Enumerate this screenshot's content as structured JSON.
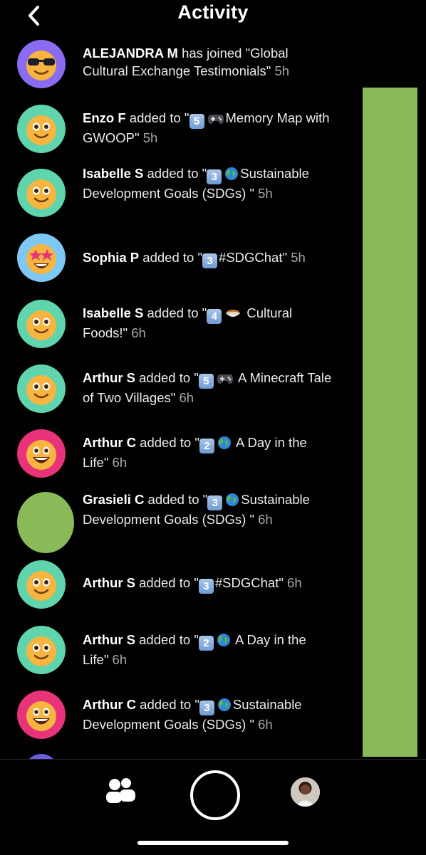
{
  "header": {
    "title": "Activity",
    "back_icon": "chevron-left-icon"
  },
  "feed": [
    {
      "avatar": "sunglasses-face",
      "user": "ALEJANDRA M",
      "pre": " has joined \"Global Cultural Exchange Testimonials\" ",
      "badge": "",
      "emoji": "",
      "text": "",
      "time": "5h"
    },
    {
      "avatar": "smiling-face",
      "user": "Enzo F",
      "pre": " added to \"",
      "badge": "5",
      "emoji": "game-controller",
      "text": "Memory Map with GWOOP\" ",
      "time": "5h"
    },
    {
      "avatar": "smiling-face",
      "user": "Isabelle S",
      "pre": " added to \"",
      "badge": "3",
      "emoji": "globe",
      "text": "Sustainable Development Goals (SDGs) \" ",
      "time": "5h"
    },
    {
      "avatar": "star-struck-face",
      "user": "Sophia P",
      "pre": " added to \"",
      "badge": "3",
      "emoji": "",
      "text": "#SDGChat\" ",
      "time": "5h"
    },
    {
      "avatar": "smiling-face",
      "user": "Isabelle S",
      "pre": " added to \"",
      "badge": "4",
      "emoji": "food-bowl",
      "text": " Cultural Foods!\" ",
      "time": "6h"
    },
    {
      "avatar": "smiling-face",
      "user": "Arthur S",
      "pre": " added to \"",
      "badge": "5",
      "emoji": "game-controller",
      "text": " A Minecraft Tale of Two Villages\" ",
      "time": "6h"
    },
    {
      "avatar": "grinning-face",
      "user": "Arthur C",
      "pre": " added to \"",
      "badge": "2",
      "emoji": "globe",
      "text": " A Day in the Life\" ",
      "time": "6h"
    },
    {
      "avatar": "green-circle",
      "user": "Grasieli C",
      "pre": " added to \"",
      "badge": "3",
      "emoji": "globe",
      "text": "Sustainable Development Goals (SDGs) \" ",
      "time": "6h"
    },
    {
      "avatar": "smiling-face",
      "user": "Arthur S",
      "pre": " added to \"",
      "badge": "3",
      "emoji": "",
      "text": "#SDGChat\" ",
      "time": "6h"
    },
    {
      "avatar": "smiling-face",
      "user": "Arthur S",
      "pre": " added to \"",
      "badge": "2",
      "emoji": "globe",
      "text": " A Day in the Life\" ",
      "time": "6h"
    },
    {
      "avatar": "grinning-face",
      "user": "Arthur C",
      "pre": " added to \"",
      "badge": "3",
      "emoji": "globe",
      "text": "Sustainable Development Goals (SDGs) \" ",
      "time": "6h"
    }
  ],
  "tabbar": {
    "friends_icon": "friends-icon",
    "capture_icon": "capture-button",
    "profile_icon": "profile-avatar"
  },
  "colors": {
    "background": "#000000",
    "green_panel": "#8aba57",
    "teal_avatar_bg": "#5fd4ad",
    "purple_avatar_bg": "#8a6cf2",
    "blue_avatar_bg": "#7ec8f5",
    "pink_avatar_bg": "#e8337a",
    "time_text": "#a8a8a8"
  }
}
